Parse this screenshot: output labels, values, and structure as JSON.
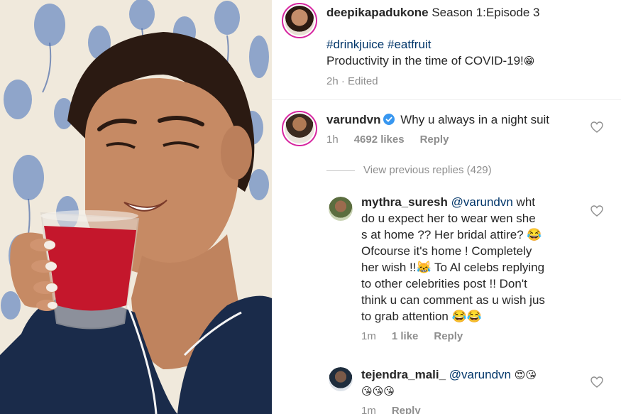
{
  "post": {
    "username": "deepikapadukone",
    "caption": "Season 1:Episode 3",
    "hashtags": "#drinkjuice #eatfruit",
    "text": "Productivity in the time of COVID-19!",
    "emoji": "😁",
    "time": "2h",
    "edited": "Edited",
    "dot": "·"
  },
  "comments": [
    {
      "username": "varundvn",
      "text": "Why u always in a night suit",
      "time": "1h",
      "likes": "4692 likes",
      "reply": "Reply"
    },
    {
      "username": "mythra_suresh",
      "mention": "@varundvn",
      "lines": [
        " wht",
        "do u expect her to wear wen she",
        "s at home ?? Her bridal attire? 😂",
        "Ofcourse it's home ! Completely",
        "her wish !!😹 To Al celebs replying",
        "to other celebrities post !! Don't",
        "think u can comment as u wish jus",
        "to grab attention 😂😂"
      ],
      "time": "1m",
      "likes": "1 like",
      "reply": "Reply"
    },
    {
      "username": "tejendra_mali_",
      "mention": "@varundvn",
      "emojis_line1": "😍😘",
      "emojis_line2": "😘😘😘",
      "time": "1m",
      "reply": "Reply"
    }
  ],
  "view_previous": "View previous replies (429)",
  "colors": {
    "link": "#003569",
    "muted": "#8e8e8e",
    "verified": "#3897f0",
    "juice": "#c4172c",
    "pajama": "#1a2b4a"
  }
}
